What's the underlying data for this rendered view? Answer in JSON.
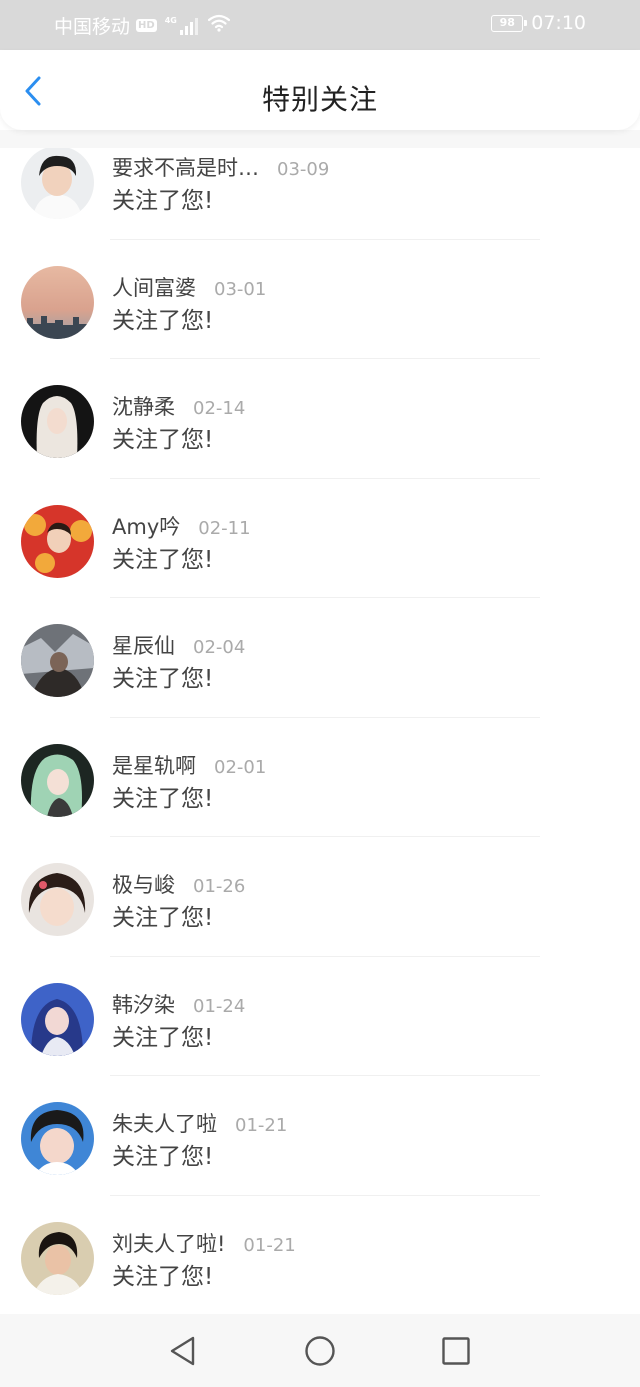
{
  "status_bar": {
    "carrier": "中国移动",
    "hd": "HD",
    "network": "4G",
    "battery": "98",
    "time": "07:10",
    "icons": [
      "hd-icon",
      "signal-icon",
      "wifi-icon",
      "battery-icon"
    ]
  },
  "header": {
    "title": "特别关注",
    "back_icon": "chevron-left-icon",
    "accent_color": "#2b8ef0"
  },
  "follows": [
    {
      "name": "要求不高是时…",
      "date": "03-09",
      "action": "关注了您!",
      "avatar": "photo-boy-white-shirt"
    },
    {
      "name": "人间富婆",
      "date": "03-01",
      "action": "关注了您!",
      "avatar": "photo-sunset-skyline"
    },
    {
      "name": "沈静柔",
      "date": "02-14",
      "action": "关注了您!",
      "avatar": "photo-blonde-girl"
    },
    {
      "name": "Amy吟",
      "date": "02-11",
      "action": "关注了您!",
      "avatar": "photo-red-tiger-costume"
    },
    {
      "name": "星辰仙",
      "date": "02-04",
      "action": "关注了您!",
      "avatar": "photo-dark-scene"
    },
    {
      "name": "是星轨啊",
      "date": "02-01",
      "action": "关注了您!",
      "avatar": "photo-green-hair-girl"
    },
    {
      "name": "极与峻",
      "date": "01-26",
      "action": "关注了您!",
      "avatar": "photo-little-girl"
    },
    {
      "name": "韩汐染",
      "date": "01-24",
      "action": "关注了您!",
      "avatar": "photo-blue-light-girl"
    },
    {
      "name": "朱夫人了啦",
      "date": "01-21",
      "action": "关注了您!",
      "avatar": "photo-boy-blue-background"
    },
    {
      "name": "刘夫人了啦!",
      "date": "01-21",
      "action": "关注了您!",
      "avatar": "photo-man-cream-background"
    }
  ],
  "nav_bar": {
    "buttons": [
      "back-triangle-icon",
      "home-circle-icon",
      "recents-square-icon"
    ]
  }
}
